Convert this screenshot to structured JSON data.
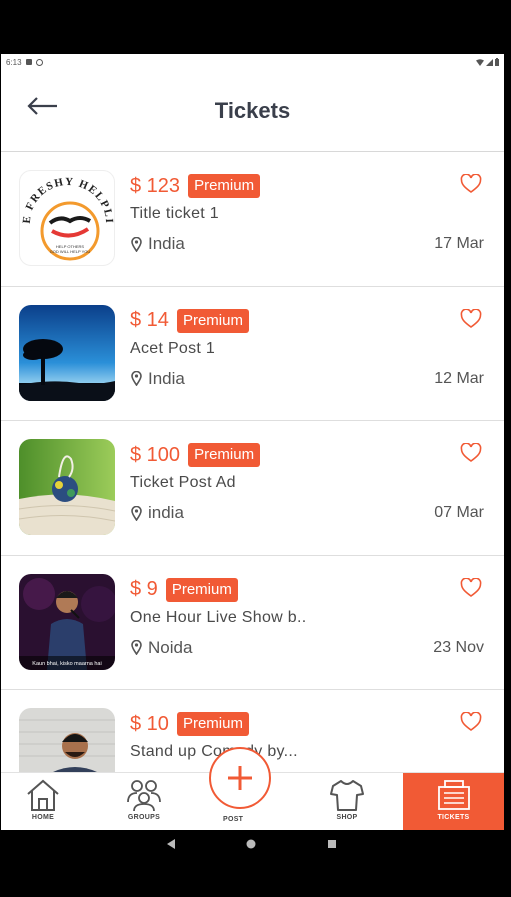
{
  "status_bar": {
    "time": "6:13"
  },
  "header": {
    "title": "Tickets"
  },
  "colors": {
    "accent": "#f15a35",
    "title": "#3a3f4b",
    "text": "#4a4a4a"
  },
  "tickets": [
    {
      "price": "$ 123",
      "badge": "Premium",
      "title": "Title ticket 1",
      "location": "India",
      "date": "17 Mar",
      "logo_lines": [
        "THE FRESHY HELPLINE",
        "HELP OTHERS",
        "GOD WILL HELP YOU"
      ]
    },
    {
      "price": "$ 14",
      "badge": "Premium",
      "title": "Acet Post 1",
      "location": "India",
      "date": "12 Mar"
    },
    {
      "price": "$ 100",
      "badge": "Premium",
      "title": "Ticket Post Ad",
      "location": "india",
      "date": "07 Mar"
    },
    {
      "price": "$ 9",
      "badge": "Premium",
      "title": "One Hour Live Show b..",
      "location": "Noida",
      "date": "23 Nov",
      "caption": "Kaun bhai, kisko maarna hai"
    },
    {
      "price": "$ 10",
      "badge": "Premium",
      "title": "Stand up Comedy by...",
      "location": "",
      "date": ""
    }
  ],
  "bottom_nav": {
    "home": "HOME",
    "groups": "GROUPS",
    "post": "POST",
    "shop": "SHOP",
    "tickets": "TICKETS"
  }
}
